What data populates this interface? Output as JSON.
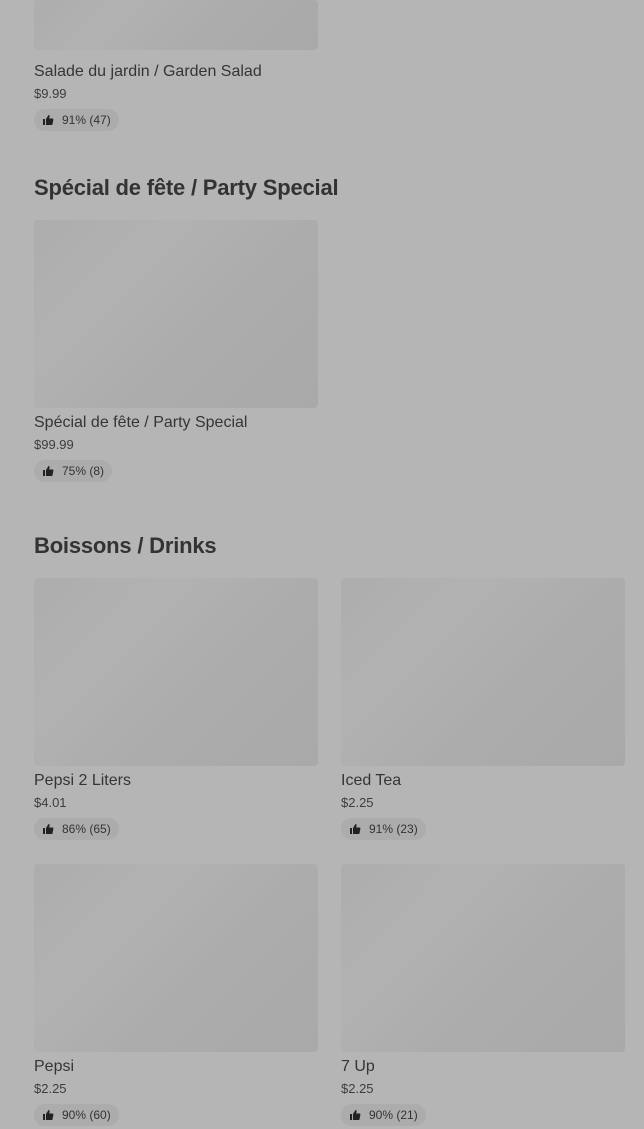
{
  "sections": [
    {
      "title": "",
      "items": [
        {
          "name": "Salade du jardin / Garden Salad",
          "price": "$9.99",
          "rating": "91% (47)"
        }
      ]
    },
    {
      "title": "Spécial de fête / Party Special",
      "items": [
        {
          "name": "Spécial de fête / Party Special",
          "price": "$99.99",
          "rating": "75% (8)"
        }
      ]
    },
    {
      "title": "Boissons / Drinks",
      "items": [
        {
          "name": "Pepsi 2 Liters",
          "price": "$4.01",
          "rating": "86% (65)"
        },
        {
          "name": "Iced Tea",
          "price": "$2.25",
          "rating": "91% (23)"
        },
        {
          "name": "Pepsi",
          "price": "$2.25",
          "rating": "90% (60)"
        },
        {
          "name": "7 Up",
          "price": "$2.25",
          "rating": "90% (21)"
        }
      ]
    }
  ],
  "icons": {
    "rating": "thumbs-up-icon"
  },
  "colors": {
    "background": "#b5b5b5",
    "image_placeholder": "#adadad",
    "rating_pill": "#acacac",
    "text": "#2b2b2b"
  }
}
